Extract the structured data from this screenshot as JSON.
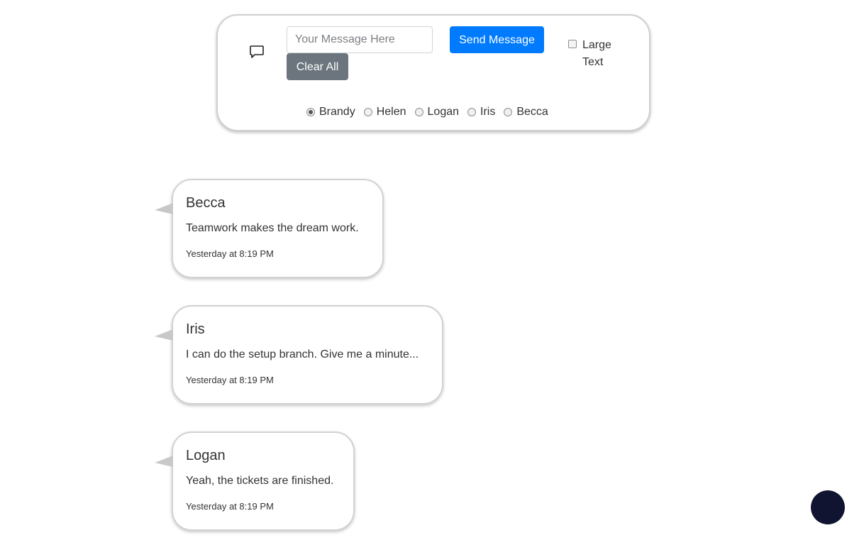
{
  "composer": {
    "message_placeholder": "Your Message Here",
    "message_value": "",
    "send_label": "Send Message",
    "clear_label": "Clear All",
    "large_text_label": "Large Text",
    "large_text_checked": false,
    "icon": "chat-bubble-icon",
    "users": [
      {
        "label": "Brandy",
        "checked": true
      },
      {
        "label": "Helen",
        "checked": false
      },
      {
        "label": "Logan",
        "checked": false
      },
      {
        "label": "Iris",
        "checked": false
      },
      {
        "label": "Becca",
        "checked": false
      }
    ]
  },
  "messages": [
    {
      "name": "Becca",
      "text": "Teamwork makes the dream work.",
      "time": "Yesterday at 8:19 PM"
    },
    {
      "name": "Iris",
      "text": "I can do the setup branch. Give me a minute...",
      "time": "Yesterday at 8:19 PM"
    },
    {
      "name": "Logan",
      "text": "Yeah, the tickets are finished.",
      "time": "Yesterday at 8:19 PM"
    }
  ],
  "colors": {
    "primary": "#007bff",
    "secondary": "#6c757d",
    "fab": "#111430"
  }
}
